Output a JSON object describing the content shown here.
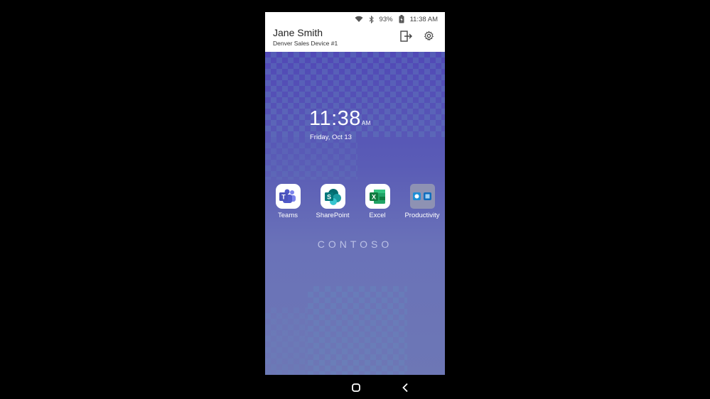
{
  "status_bar": {
    "battery": "93%",
    "time": "11:38 AM"
  },
  "header": {
    "user_name": "Jane Smith",
    "device_name": "Denver Sales Device #1"
  },
  "lock_clock": {
    "time": "11:38",
    "ampm": "AM",
    "date": "Friday, Oct 13"
  },
  "apps": [
    {
      "label": "Teams",
      "icon": "teams-icon",
      "color": "#5059c9"
    },
    {
      "label": "SharePoint",
      "icon": "sharepoint-icon",
      "color": "#038387"
    },
    {
      "label": "Excel",
      "icon": "excel-icon",
      "color": "#107c41"
    },
    {
      "label": "Productivity",
      "icon": "folder-icon",
      "color": "#7b7fa6"
    }
  ],
  "wallpaper": {
    "brand": "CONTOSO"
  }
}
